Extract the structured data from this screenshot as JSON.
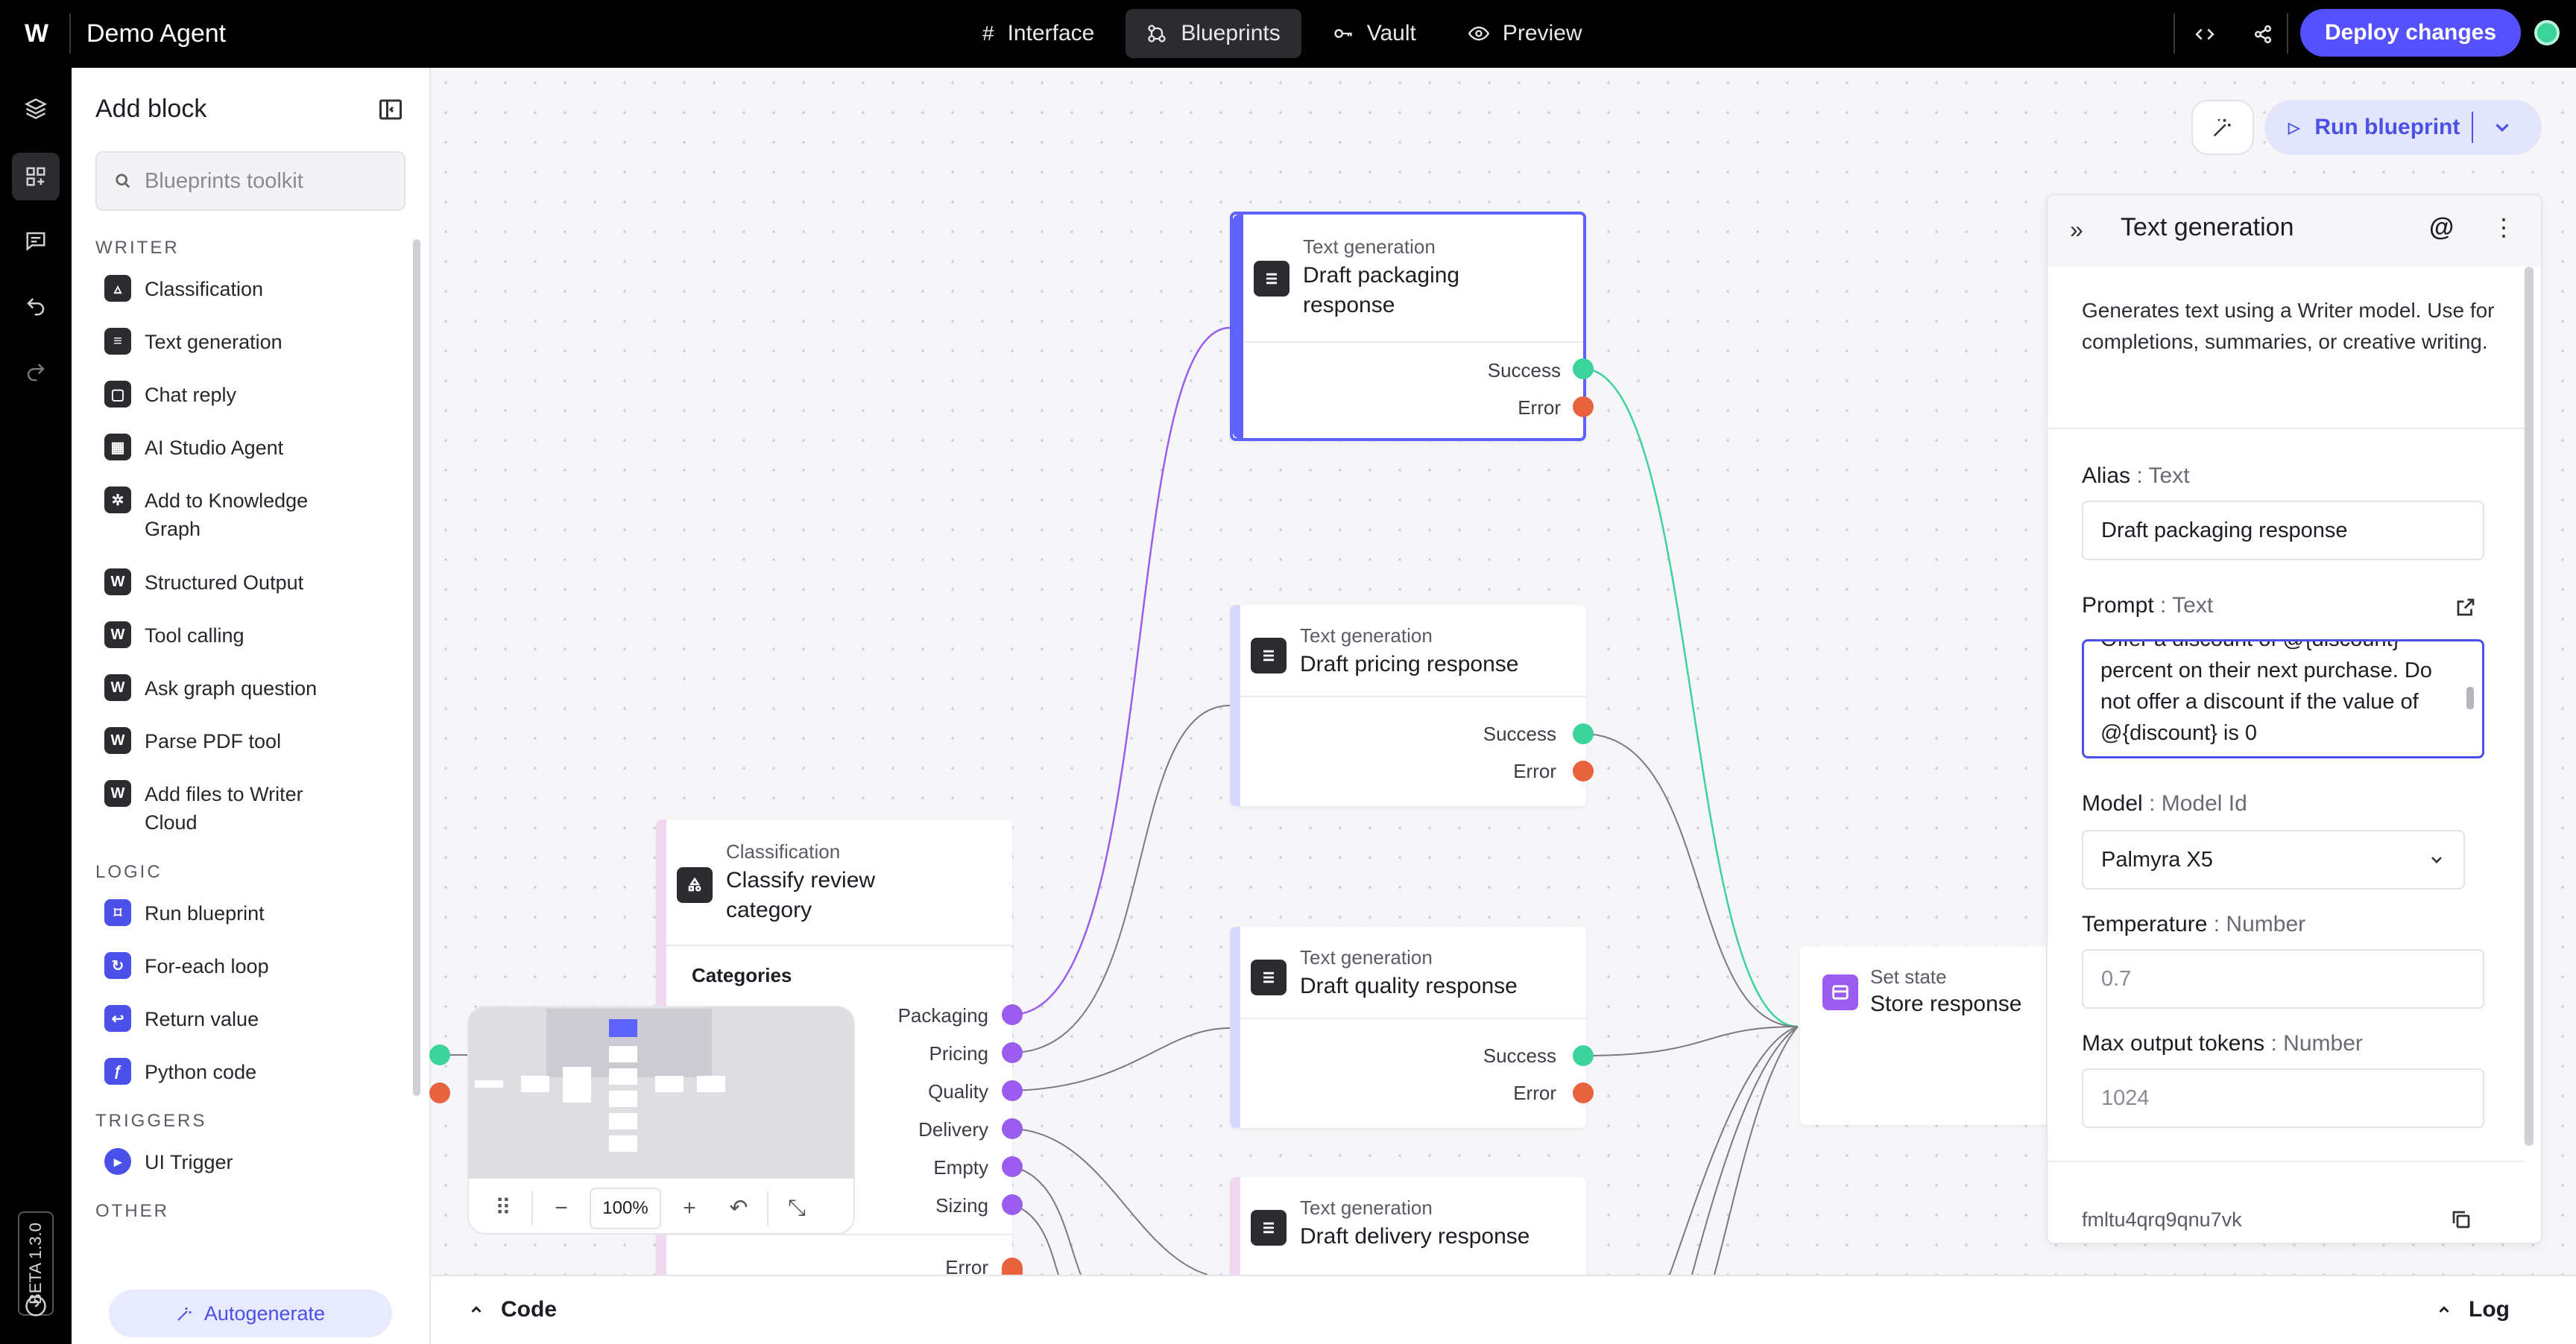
{
  "app": {
    "title": "Demo Agent",
    "logo": "W"
  },
  "tabs": [
    {
      "label": "Interface",
      "icon": "hash-icon",
      "active": false
    },
    {
      "label": "Blueprints",
      "icon": "blueprint-icon",
      "active": true
    },
    {
      "label": "Vault",
      "icon": "key-icon",
      "active": false
    },
    {
      "label": "Preview",
      "icon": "eye-icon",
      "active": false
    }
  ],
  "toolbar": {
    "deploy_label": "Deploy changes"
  },
  "rail": {
    "beta_label": "BETA 1.3.0"
  },
  "sidebar": {
    "title": "Add block",
    "search_placeholder": "Blueprints toolkit",
    "sections": [
      {
        "title": "WRITER",
        "items": [
          {
            "label": "Classification",
            "icon": "classification-icon"
          },
          {
            "label": "Text generation",
            "icon": "text-icon"
          },
          {
            "label": "Chat reply",
            "icon": "chat-icon"
          },
          {
            "label": "AI Studio Agent",
            "icon": "agent-icon"
          },
          {
            "label": "Add to Knowledge Graph",
            "icon": "graph-icon"
          },
          {
            "label": "Structured Output",
            "icon": "writer-icon"
          },
          {
            "label": "Tool calling",
            "icon": "writer-icon"
          },
          {
            "label": "Ask graph question",
            "icon": "writer-icon"
          },
          {
            "label": "Parse PDF tool",
            "icon": "writer-icon"
          },
          {
            "label": "Add files to Writer Cloud",
            "icon": "writer-icon"
          }
        ]
      },
      {
        "title": "LOGIC",
        "items": [
          {
            "label": "Run blueprint",
            "icon": "run-blueprint-icon"
          },
          {
            "label": "For-each loop",
            "icon": "loop-icon"
          },
          {
            "label": "Return value",
            "icon": "return-icon"
          },
          {
            "label": "Python code",
            "icon": "function-icon"
          }
        ]
      },
      {
        "title": "TRIGGERS",
        "items": [
          {
            "label": "UI Trigger",
            "icon": "trigger-icon"
          }
        ]
      },
      {
        "title": "OTHER",
        "items": []
      }
    ],
    "autogenerate_label": "Autogenerate"
  },
  "canvas": {
    "run_label": "Run blueprint",
    "nodes": {
      "draft_packaging": {
        "type": "Text generation",
        "title": "Draft packaging response",
        "success": "Success",
        "error": "Error"
      },
      "draft_pricing": {
        "type": "Text generation",
        "title": "Draft pricing response",
        "success": "Success",
        "error": "Error"
      },
      "draft_quality": {
        "type": "Text generation",
        "title": "Draft quality response",
        "success": "Success",
        "error": "Error"
      },
      "draft_delivery": {
        "type": "Text generation",
        "title": "Draft delivery response"
      },
      "classify": {
        "type": "Classification",
        "title": "Classify review category",
        "categories_label": "Categories",
        "categories": [
          "Packaging",
          "Pricing",
          "Quality",
          "Delivery",
          "Empty",
          "Sizing"
        ],
        "error": "Error"
      },
      "store": {
        "type": "Set state",
        "title": "Store response"
      }
    },
    "minimap": {
      "zoom": "100%"
    }
  },
  "panel": {
    "title": "Text generation",
    "description": "Generates text using a Writer model. Use for completions, summaries, or creative writing.",
    "alias_label": "Alias",
    "alias_type": ": Text",
    "alias_value": "Draft packaging response",
    "prompt_label": "Prompt",
    "prompt_type": ": Text",
    "prompt_value": "Offer a discount of @{discount} percent on their next purchase. Do not offer a discount if the value of @{discount} is 0",
    "model_label": "Model",
    "model_type": ": Model Id",
    "model_value": "Palmyra X5",
    "temperature_label": "Temperature",
    "temperature_type": ": Number",
    "temperature_placeholder": "0.7",
    "max_tokens_label": "Max output tokens",
    "max_tokens_type": ": Number",
    "max_tokens_placeholder": "1024",
    "block_id": "fmltu4qrq9qnu7vk"
  },
  "bottom": {
    "code_label": "Code",
    "log_label": "Log"
  },
  "colors": {
    "accent": "#5551ff",
    "success": "#3dd39c",
    "error": "#e8623e",
    "category": "#9b5cf0"
  }
}
